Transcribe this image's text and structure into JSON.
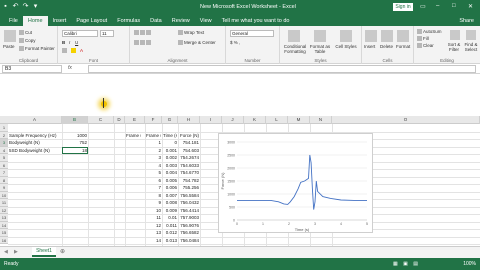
{
  "window": {
    "title": "New Microsoft Excel Worksheet - Excel",
    "signin": "Sign in",
    "share": "Share"
  },
  "tabs": [
    "File",
    "Home",
    "Insert",
    "Page Layout",
    "Formulas",
    "Data",
    "Review",
    "View",
    "Tell me what you want to do"
  ],
  "ribbon": {
    "clipboard": {
      "label": "Clipboard",
      "paste": "Paste",
      "cut": "Cut",
      "copy": "Copy",
      "format_painter": "Format Painter"
    },
    "font": {
      "label": "Font",
      "family": "Calibri",
      "size": "11"
    },
    "alignment": {
      "label": "Alignment",
      "wrap": "Wrap Text",
      "merge": "Merge & Center"
    },
    "number": {
      "label": "Number",
      "format": "General"
    },
    "styles": {
      "label": "Styles",
      "conditional": "Conditional Formatting",
      "format_table": "Format as Table",
      "cell_styles": "Cell Styles"
    },
    "cells": {
      "label": "Cells",
      "insert": "Insert",
      "delete": "Delete",
      "format": "Format"
    },
    "editing": {
      "label": "Editing",
      "autosum": "AutoSum",
      "fill": "Fill",
      "clear": "Clear",
      "sort": "Sort & Filter",
      "find": "Find & Select"
    }
  },
  "formula_bar": {
    "name_box": "B3",
    "value": ""
  },
  "columns": [
    "A",
    "B",
    "C",
    "D",
    "E",
    "F",
    "G",
    "H",
    "I",
    "J",
    "K",
    "L",
    "M",
    "N",
    "O"
  ],
  "rows": [
    "1",
    "2",
    "3",
    "4",
    "5",
    "6",
    "7",
    "8",
    "9",
    "10",
    "11",
    "12",
    "13",
    "14",
    "15",
    "16"
  ],
  "cells_a": [
    "",
    "Sample Frequency (Hz)",
    "Bodyweight (N)",
    "5SD Bodyweight (N)"
  ],
  "cells_b": [
    "",
    "1000",
    "752",
    "18"
  ],
  "table": {
    "headers": [
      "Frame #",
      "Time (s)",
      "Force (N)"
    ],
    "frames": [
      "1",
      "2",
      "3",
      "4",
      "5",
      "6",
      "7",
      "8",
      "9",
      "10",
      "11",
      "12",
      "13",
      "14",
      "15"
    ],
    "times": [
      "0",
      "0.001",
      "0.002",
      "0.003",
      "0.004",
      "0.005",
      "0.006",
      "0.007",
      "0.008",
      "0.009",
      "0.01",
      "0.011",
      "0.012",
      "0.013",
      "0.014"
    ],
    "forces": [
      "754.181",
      "754.603",
      "754.2674",
      "754.6033",
      "754.6770",
      "754.782",
      "755.256",
      "756.5584",
      "756.0432",
      "756.4414",
      "757.9003",
      "756.9076",
      "756.6582",
      "756.0484",
      "756.8023"
    ]
  },
  "chart_data": {
    "type": "line",
    "xlabel": "Time (s)",
    "ylabel": "Force (N)",
    "xlim": [
      0,
      5
    ],
    "ylim": [
      0,
      3000
    ],
    "xticks": [
      "0",
      "1",
      "2",
      "3",
      "4",
      "5"
    ],
    "yticks": [
      "0",
      "500",
      "1000",
      "1500",
      "2000",
      "2500",
      "3000"
    ],
    "series": [
      {
        "x": [
          0,
          0.5,
          1,
          1.3,
          1.6,
          1.8,
          1.95,
          2.05,
          2.2,
          2.35,
          2.45,
          2.6,
          2.75,
          2.8,
          2.85,
          2.9,
          2.95,
          3.0,
          3.05,
          3.1,
          3.3,
          3.6,
          4,
          4.5,
          5
        ],
        "y": [
          754,
          754,
          754,
          752,
          700,
          620,
          600,
          700,
          900,
          1200,
          1450,
          1500,
          1600,
          2500,
          2200,
          1200,
          400,
          700,
          1500,
          1100,
          900,
          830,
          770,
          755,
          754
        ]
      }
    ],
    "line_color": "#4472c4"
  },
  "sheet": {
    "tab": "Sheet1"
  },
  "status": {
    "ready": "Ready",
    "zoom": "100%"
  }
}
